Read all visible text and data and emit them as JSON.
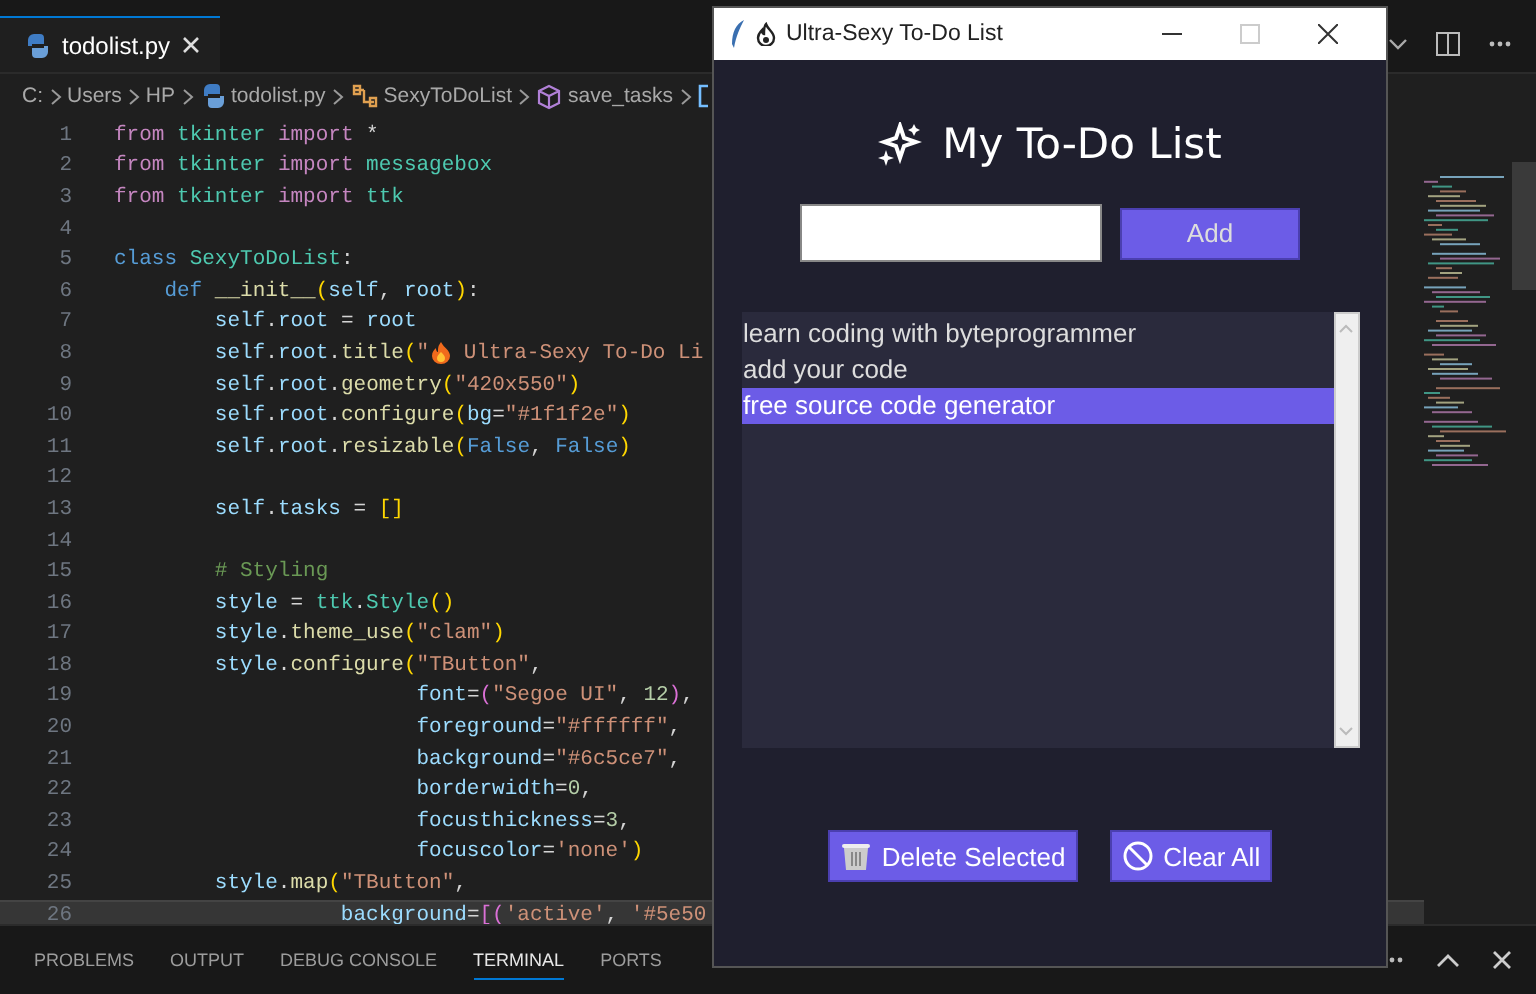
{
  "editor": {
    "tab": {
      "label": "todolist.py",
      "selected": true
    },
    "breadcrumbs": [
      "C:",
      "Users",
      "HP",
      "todolist.py",
      "SexyToDoList",
      "save_tasks"
    ],
    "lines": [
      {
        "n": "1",
        "current": false,
        "tokens": [
          {
            "text": "from",
            "kind": "kw"
          },
          {
            "text": " tkinter",
            "kind": "mod"
          },
          {
            "text": " import",
            "kind": "kw"
          },
          {
            "text": " *",
            "kind": "p"
          }
        ]
      },
      {
        "n": "2",
        "current": false,
        "tokens": [
          {
            "text": "from",
            "kind": "kw"
          },
          {
            "text": " tkinter",
            "kind": "mod"
          },
          {
            "text": " import",
            "kind": "kw"
          },
          {
            "text": " messagebox",
            "kind": "mod"
          }
        ]
      },
      {
        "n": "3",
        "current": false,
        "tokens": [
          {
            "text": "from",
            "kind": "kw"
          },
          {
            "text": " tkinter",
            "kind": "mod"
          },
          {
            "text": " import",
            "kind": "kw"
          },
          {
            "text": " ttk",
            "kind": "mod"
          }
        ]
      },
      {
        "n": "4",
        "current": false
      },
      {
        "n": "5",
        "current": false,
        "tokens": [
          {
            "text": "class",
            "kind": "def"
          },
          {
            "text": " SexyToDoList",
            "kind": "mod"
          },
          {
            "text": ":",
            "kind": "p"
          }
        ]
      },
      {
        "n": "6",
        "current": false,
        "tokens": [
          {
            "text": "    def",
            "kind": "def"
          },
          {
            "text": " __init__",
            "kind": "fn"
          },
          {
            "text": "(",
            "kind": "br"
          },
          {
            "text": "self",
            "kind": "var"
          },
          {
            "text": ", ",
            "kind": "p"
          },
          {
            "text": "root",
            "kind": "var"
          },
          {
            "text": ")",
            "kind": "br"
          },
          {
            "text": ":",
            "kind": "p"
          }
        ]
      },
      {
        "n": "7",
        "current": false,
        "tokens": [
          {
            "text": "        self",
            "kind": "var"
          },
          {
            "text": ".",
            "kind": "p"
          },
          {
            "text": "root",
            "kind": "var"
          },
          {
            "text": " = ",
            "kind": "p"
          },
          {
            "text": "root",
            "kind": "var"
          }
        ]
      },
      {
        "n": "8",
        "current": false,
        "tokens": [
          {
            "text": "        self",
            "kind": "var"
          },
          {
            "text": ".",
            "kind": "p"
          },
          {
            "text": "root",
            "kind": "var"
          },
          {
            "text": ".",
            "kind": "p"
          },
          {
            "text": "title",
            "kind": "fn"
          },
          {
            "text": "(",
            "kind": "br"
          },
          {
            "text": "\"",
            "kind": "str"
          },
          {
            "kind": "fire"
          },
          {
            "text": " Ultra-Sexy To-Do Li",
            "kind": "str"
          }
        ]
      },
      {
        "n": "9",
        "current": false,
        "tokens": [
          {
            "text": "        self",
            "kind": "var"
          },
          {
            "text": ".",
            "kind": "p"
          },
          {
            "text": "root",
            "kind": "var"
          },
          {
            "text": ".",
            "kind": "p"
          },
          {
            "text": "geometry",
            "kind": "fn"
          },
          {
            "text": "(",
            "kind": "br"
          },
          {
            "text": "\"420x550\"",
            "kind": "str"
          },
          {
            "text": ")",
            "kind": "br"
          }
        ]
      },
      {
        "n": "10",
        "current": false,
        "tokens": [
          {
            "text": "        self",
            "kind": "var"
          },
          {
            "text": ".",
            "kind": "p"
          },
          {
            "text": "root",
            "kind": "var"
          },
          {
            "text": ".",
            "kind": "p"
          },
          {
            "text": "configure",
            "kind": "fn"
          },
          {
            "text": "(",
            "kind": "br"
          },
          {
            "text": "bg",
            "kind": "var"
          },
          {
            "text": "=",
            "kind": "p"
          },
          {
            "text": "\"#1f1f2e\"",
            "kind": "str"
          },
          {
            "text": ")",
            "kind": "br"
          }
        ]
      },
      {
        "n": "11",
        "current": false,
        "tokens": [
          {
            "text": "        self",
            "kind": "var"
          },
          {
            "text": ".",
            "kind": "p"
          },
          {
            "text": "root",
            "kind": "var"
          },
          {
            "text": ".",
            "kind": "p"
          },
          {
            "text": "resizable",
            "kind": "fn"
          },
          {
            "text": "(",
            "kind": "br"
          },
          {
            "text": "False",
            "kind": "def"
          },
          {
            "text": ", ",
            "kind": "p"
          },
          {
            "text": "False",
            "kind": "def"
          },
          {
            "text": ")",
            "kind": "br"
          }
        ]
      },
      {
        "n": "12",
        "current": false
      },
      {
        "n": "13",
        "current": false,
        "tokens": [
          {
            "text": "        self",
            "kind": "var"
          },
          {
            "text": ".",
            "kind": "p"
          },
          {
            "text": "tasks",
            "kind": "var"
          },
          {
            "text": " = ",
            "kind": "p"
          },
          {
            "text": "[]",
            "kind": "br"
          }
        ]
      },
      {
        "n": "14",
        "current": false
      },
      {
        "n": "15",
        "current": false,
        "tokens": [
          {
            "text": "        # Styling",
            "kind": "com"
          }
        ]
      },
      {
        "n": "16",
        "current": false,
        "tokens": [
          {
            "text": "        style",
            "kind": "var"
          },
          {
            "text": " = ",
            "kind": "p"
          },
          {
            "text": "ttk",
            "kind": "mod"
          },
          {
            "text": ".",
            "kind": "p"
          },
          {
            "text": "Style",
            "kind": "mod"
          },
          {
            "text": "()",
            "kind": "br"
          }
        ]
      },
      {
        "n": "17",
        "current": false,
        "tokens": [
          {
            "text": "        style",
            "kind": "var"
          },
          {
            "text": ".",
            "kind": "p"
          },
          {
            "text": "theme_use",
            "kind": "fn"
          },
          {
            "text": "(",
            "kind": "br"
          },
          {
            "text": "\"clam\"",
            "kind": "str"
          },
          {
            "text": ")",
            "kind": "br"
          }
        ]
      },
      {
        "n": "18",
        "current": false,
        "tokens": [
          {
            "text": "        style",
            "kind": "var"
          },
          {
            "text": ".",
            "kind": "p"
          },
          {
            "text": "configure",
            "kind": "fn"
          },
          {
            "text": "(",
            "kind": "br"
          },
          {
            "text": "\"TButton\"",
            "kind": "str"
          },
          {
            "text": ",",
            "kind": "p"
          }
        ]
      },
      {
        "n": "19",
        "current": false,
        "tokens": [
          {
            "text": "                        font",
            "kind": "var"
          },
          {
            "text": "=",
            "kind": "p"
          },
          {
            "text": "(",
            "kind": "br2"
          },
          {
            "text": "\"Segoe UI\"",
            "kind": "str"
          },
          {
            "text": ", ",
            "kind": "p"
          },
          {
            "text": "12",
            "kind": "num"
          },
          {
            "text": ")",
            "kind": "br2"
          },
          {
            "text": ",",
            "kind": "p"
          }
        ]
      },
      {
        "n": "20",
        "current": false,
        "tokens": [
          {
            "text": "                        foreground",
            "kind": "var"
          },
          {
            "text": "=",
            "kind": "p"
          },
          {
            "text": "\"#ffffff\"",
            "kind": "str"
          },
          {
            "text": ",",
            "kind": "p"
          }
        ]
      },
      {
        "n": "21",
        "current": false,
        "tokens": [
          {
            "text": "                        background",
            "kind": "var"
          },
          {
            "text": "=",
            "kind": "p"
          },
          {
            "text": "\"#6c5ce7\"",
            "kind": "str"
          },
          {
            "text": ",",
            "kind": "p"
          }
        ]
      },
      {
        "n": "22",
        "current": false,
        "tokens": [
          {
            "text": "                        borderwidth",
            "kind": "var"
          },
          {
            "text": "=",
            "kind": "p"
          },
          {
            "text": "0",
            "kind": "num"
          },
          {
            "text": ",",
            "kind": "p"
          }
        ]
      },
      {
        "n": "23",
        "current": false,
        "tokens": [
          {
            "text": "                        focusthickness",
            "kind": "var"
          },
          {
            "text": "=",
            "kind": "p"
          },
          {
            "text": "3",
            "kind": "num"
          },
          {
            "text": ",",
            "kind": "p"
          }
        ]
      },
      {
        "n": "24",
        "current": false,
        "tokens": [
          {
            "text": "                        focuscolor",
            "kind": "var"
          },
          {
            "text": "=",
            "kind": "p"
          },
          {
            "text": "'none'",
            "kind": "str"
          },
          {
            "text": ")",
            "kind": "br"
          }
        ]
      },
      {
        "n": "25",
        "current": false,
        "tokens": [
          {
            "text": "        style",
            "kind": "var"
          },
          {
            "text": ".",
            "kind": "p"
          },
          {
            "text": "map",
            "kind": "fn"
          },
          {
            "text": "(",
            "kind": "br"
          },
          {
            "text": "\"TButton\"",
            "kind": "str"
          },
          {
            "text": ",",
            "kind": "p"
          }
        ]
      },
      {
        "n": "26",
        "current": true,
        "tokens": [
          {
            "text": "                  background",
            "kind": "var"
          },
          {
            "text": "=",
            "kind": "p"
          },
          {
            "text": "[(",
            "kind": "br2"
          },
          {
            "text": "'active'",
            "kind": "str"
          },
          {
            "text": ", ",
            "kind": "p"
          },
          {
            "text": "'#5e50",
            "kind": "str"
          }
        ]
      }
    ],
    "panel_tabs": [
      {
        "label": "PROBLEMS",
        "selected": false
      },
      {
        "label": "OUTPUT",
        "selected": false
      },
      {
        "label": "DEBUG CONSOLE",
        "selected": false
      },
      {
        "label": "TERMINAL",
        "selected": true
      },
      {
        "label": "PORTS",
        "selected": false
      }
    ]
  },
  "app": {
    "window": {
      "title": "Ultra-Sexy To-Do List"
    },
    "heading": "My To-Do List",
    "add_button": "Add",
    "tasks": [
      {
        "label": "learn coding with byteprogrammer",
        "selected": false
      },
      {
        "label": "add your code",
        "selected": false
      },
      {
        "label": "free source code generator",
        "selected": true
      }
    ],
    "buttons": [
      {
        "label": "Delete Selected",
        "kind": "delete"
      },
      {
        "label": "Clear All",
        "kind": "clear"
      }
    ]
  }
}
